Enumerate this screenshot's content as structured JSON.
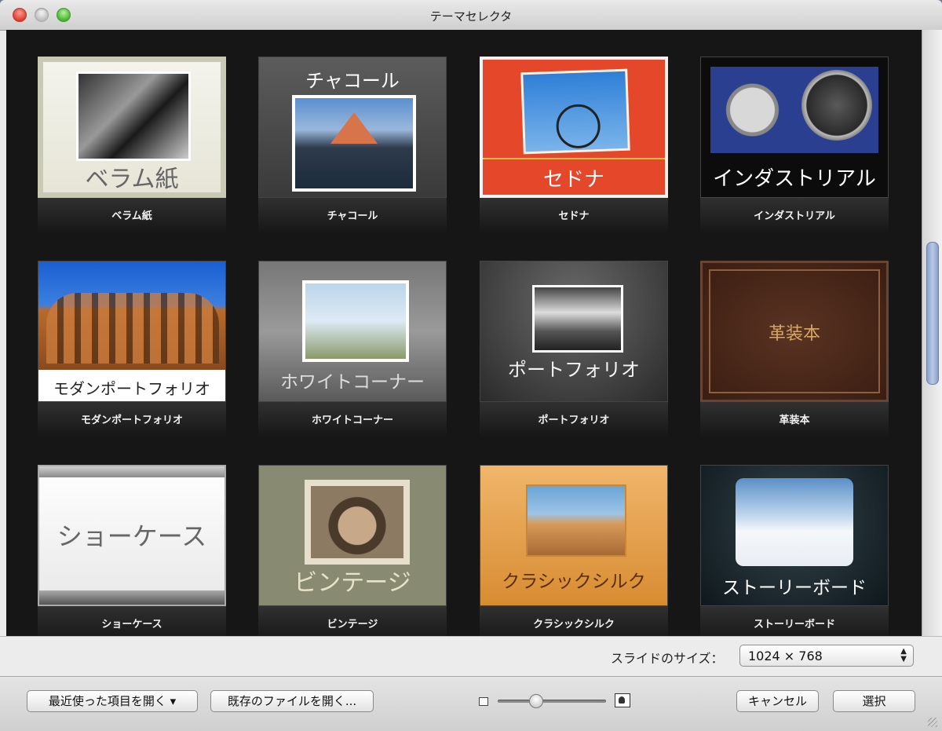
{
  "window": {
    "title": "テーマセレクタ"
  },
  "themes": [
    {
      "label": "ベラム紙",
      "thumb_title": "ベラム紙"
    },
    {
      "label": "チャコール",
      "thumb_title": "チャコール"
    },
    {
      "label": "セドナ",
      "thumb_title": "セドナ"
    },
    {
      "label": "インダストリアル",
      "thumb_title": "インダストリアル"
    },
    {
      "label": "モダンポートフォリオ",
      "thumb_title": "モダンポートフォリオ"
    },
    {
      "label": "ホワイトコーナー",
      "thumb_title": "ホワイトコーナー"
    },
    {
      "label": "ポートフォリオ",
      "thumb_title": "ポートフォリオ"
    },
    {
      "label": "革装本",
      "thumb_title": "革装本"
    },
    {
      "label": "ショーケース",
      "thumb_title": "ショーケース"
    },
    {
      "label": "ビンテージ",
      "thumb_title": "ビンテージ"
    },
    {
      "label": "クラシックシルク",
      "thumb_title": "クラシックシルク"
    },
    {
      "label": "ストーリーボード",
      "thumb_title": "ストーリーボード"
    }
  ],
  "slide_size": {
    "label": "スライドのサイズ：",
    "value": "1024 × 768"
  },
  "footer": {
    "recent_label": "最近使った項目を開く ▾",
    "open_existing_label": "既存のファイルを開く...",
    "cancel_label": "キャンセル",
    "select_label": "選択"
  }
}
